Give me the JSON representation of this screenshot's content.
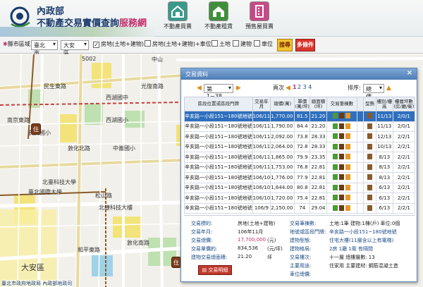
{
  "header": {
    "ministry": "內政部",
    "title_main": "不動產交易實價查詢",
    "title_accent": "服務網",
    "nav": [
      {
        "label": "不動產買賣",
        "color": "#3a9a8a",
        "icon": "house-icon"
      },
      {
        "label": "不動產租賃",
        "color": "#3f8f3a",
        "icon": "house-rent-icon"
      },
      {
        "label": "預售屋買賣",
        "color": "#c64a86",
        "icon": "building-icon"
      }
    ]
  },
  "filters": {
    "area_label": "縣市區域",
    "city": "臺北市",
    "district": "大安區",
    "options": [
      {
        "label": "房地(土地+建物)",
        "checked": true
      },
      {
        "label": "房地(土地+建物)+車位",
        "checked": false
      },
      {
        "label": "土地",
        "checked": false
      },
      {
        "label": "建物",
        "checked": false
      },
      {
        "label": "車位",
        "checked": false
      }
    ],
    "search_label": "搜尋",
    "cond_label": "多條件"
  },
  "map": {
    "labels": [
      {
        "text": "5002",
        "cls": ""
      },
      {
        "text": "中山",
        "cls": ""
      },
      {
        "text": "光復南路",
        "cls": ""
      },
      {
        "text": "民生東路",
        "cls": ""
      },
      {
        "text": "西湖國中",
        "cls": ""
      },
      {
        "text": "西湖國小",
        "cls": ""
      },
      {
        "text": "南京東路",
        "cls": ""
      },
      {
        "text": "長安國小",
        "cls": ""
      },
      {
        "text": "敦化北路",
        "cls": ""
      },
      {
        "text": "中崙國小",
        "cls": ""
      },
      {
        "text": "北臺科技大學",
        "cls": ""
      },
      {
        "text": "臺北國際大學",
        "cls": ""
      },
      {
        "text": "松山路",
        "cls": ""
      },
      {
        "text": "北捷科技大樓",
        "cls": ""
      },
      {
        "text": "大安區",
        "cls": "big"
      },
      {
        "text": "敦化南路",
        "cls": ""
      },
      {
        "text": "和平東路",
        "cls": ""
      }
    ],
    "pin_label": "住",
    "footer": "臺北市政府地政局 內政部地政司"
  },
  "dialog": {
    "title": "交易資料",
    "close": "×",
    "page_select": "第 1~38 筆",
    "page_label": "頁次",
    "page_current": "1",
    "pages": "2 3 4",
    "sort_label": "排序:",
    "sort_value": "總價",
    "columns": [
      "區段位置或區段門牌",
      "交易年月",
      "總價(萬)",
      "單價(萬/坪)",
      "總面積(坪)",
      "交易筆棟數",
      "",
      "型態",
      "樓別/樓高",
      "樓層坪數(房/廳/衛)"
    ],
    "rows": [
      {
        "addr": "辛亥路一小段151~180號地號",
        "date": "106/11",
        "total": "1,770.00",
        "unit": "81.5",
        "area": "21.20",
        "floor": "11/13",
        "rooms": "2/0/1",
        "selected": true
      },
      {
        "addr": "辛亥路一小段151~180號地號",
        "date": "106/11",
        "total": "1,790.00",
        "unit": "84.4",
        "area": "21.20",
        "floor": "11/13",
        "rooms": "2/0/1",
        "selected": false
      },
      {
        "addr": "辛亥路一小段151~180號地號",
        "date": "106/11",
        "total": "2,092.00",
        "unit": "73.8",
        "area": "28.33",
        "floor": "12/13",
        "rooms": "2/2/1",
        "selected": false
      },
      {
        "addr": "辛亥路一小段151~180號地號",
        "date": "106/11",
        "total": "2,064.00",
        "unit": "72.8",
        "area": "28.33",
        "floor": "10/13",
        "rooms": "2/2/1",
        "selected": false
      },
      {
        "addr": "辛亥路一小段151~180號地號",
        "date": "106/11",
        "total": "1,865.00",
        "unit": "79.9",
        "area": "23.35",
        "floor": "8/13",
        "rooms": "2/2/1",
        "selected": false
      },
      {
        "addr": "辛亥路一小段151~180號地號",
        "date": "106/11",
        "total": "1,753.00",
        "unit": "76.8",
        "area": "22.81",
        "floor": "8/13",
        "rooms": "2/2/1",
        "selected": false
      },
      {
        "addr": "辛亥路一小段151~180號地號",
        "date": "106/10",
        "total": "1,776.00",
        "unit": "77.9",
        "area": "22.81",
        "floor": "8/13",
        "rooms": "2/2/1",
        "selected": false
      },
      {
        "addr": "辛亥路一小段151~180號地號",
        "date": "106/10",
        "total": "1,644.00",
        "unit": "80.8",
        "area": "22.81",
        "floor": "6/13",
        "rooms": "2/2/1",
        "selected": false
      },
      {
        "addr": "辛亥路一小段151~180號地號",
        "date": "106/10",
        "total": "1,720.00",
        "unit": "75.4",
        "area": "22.81",
        "floor": "6/13",
        "rooms": "2/2/1",
        "selected": false
      },
      {
        "addr": "辛亥路一小段151~180號地號",
        "date": "106/9",
        "total": "2,150.00",
        "unit": "74",
        "area": "29.04",
        "floor": "6/13",
        "rooms": "2/2/1",
        "selected": false
      }
    ],
    "detail": {
      "left": [
        {
          "label": "交易標的:",
          "value": "房地(土地+建物)"
        },
        {
          "label": "交易年月:",
          "value": "106年11月"
        },
        {
          "label": "交易總價:",
          "value": "17,700,000",
          "unit": "(元)"
        },
        {
          "label": "交易單價約:",
          "value": "834,536",
          "unit": "(元/坪)"
        },
        {
          "label": "建物交易總面積:",
          "value": "21.20",
          "unit": "坪"
        }
      ],
      "right": [
        {
          "label": "交易筆棟數:",
          "value": "土地:1筆 建物:1棟(戶) 車位:0個"
        },
        {
          "label": "地號或區段門牌:",
          "value": "辛亥路一小段151~180號地號"
        },
        {
          "label": "建物型態:",
          "value": "住宅大樓(11層含以上有電梯)"
        },
        {
          "label": "建物格局:",
          "value": "2房 1廳 1衛 有隔間"
        },
        {
          "label": "交易樓次:",
          "value": "十一層  總樓層數: 13"
        },
        {
          "label": "主要用途:",
          "value": "住家用  主要建材: 鋼筋混凝土造"
        },
        {
          "label": "車位總價:",
          "value": ""
        }
      ],
      "button": "交易明細"
    }
  }
}
